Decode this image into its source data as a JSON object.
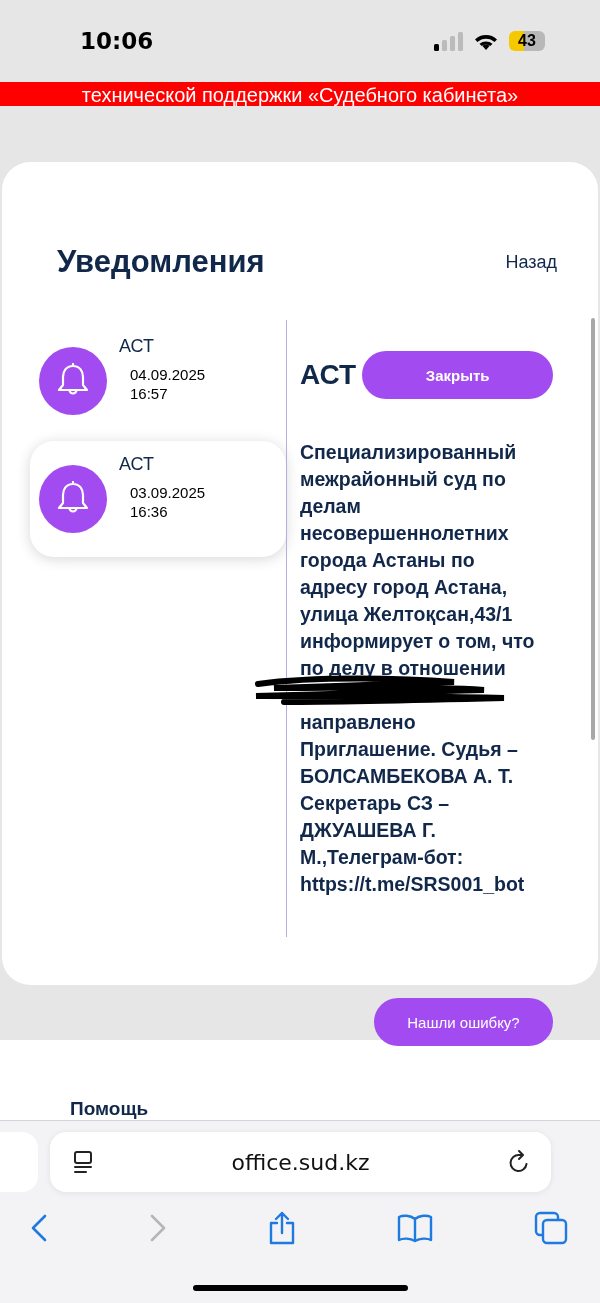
{
  "status_bar": {
    "time": "10:06",
    "battery": "43"
  },
  "banner": {
    "text": "технической поддержки «Судебного кабинета»"
  },
  "page": {
    "title": "Уведомления",
    "back_link": "Назад"
  },
  "notifications": [
    {
      "title": "АСТ",
      "date": "04.09.2025",
      "time": "16:57",
      "selected": false
    },
    {
      "title": "АСТ",
      "date": "03.09.2025",
      "time": "16:36",
      "selected": true
    }
  ],
  "detail": {
    "title": "АСТ",
    "close_button": "Закрыть",
    "text_parts": [
      "Специализированный межрайонный суд по делам несовершеннолетних города Астаны по адресу город Астана, улица Желтоқсан,43/1 информирует о том, что по делу в отношении",
      "направлено Приглашение. Судья – БОЛСАМБЕКОВА А. Т. Секретарь СЗ – ДЖУАШЕВА Г. М.,Телеграм-бот: https://t.me/SRS001_bot"
    ],
    "redacted": true
  },
  "report_button": "Нашли ошибку?",
  "footer": {
    "heading": "Помощь"
  },
  "browser": {
    "url": "office.sud.kz"
  }
}
